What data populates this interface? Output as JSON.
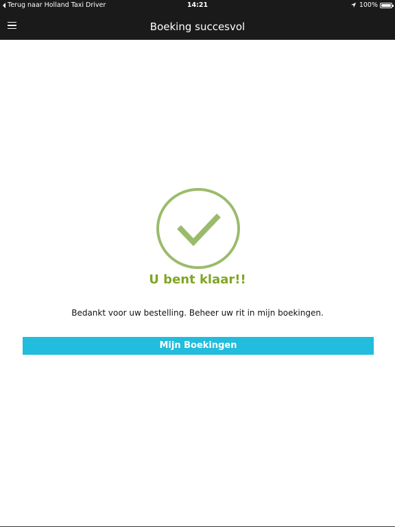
{
  "status_bar": {
    "back_label": "Terug naar Holland Taxi Driver",
    "time": "14:21",
    "battery_percent": "100%",
    "location_icon": "location-arrow-icon",
    "battery_icon": "battery-icon"
  },
  "nav_bar": {
    "title": "Boeking succesvol",
    "menu_icon": "hamburger-menu-icon"
  },
  "confirmation": {
    "icon": "checkmark-circle-icon",
    "title": "U bent klaar!!",
    "message": "Bedankt voor uw bestelling. Beheer uw rit in mijn boekingen.",
    "button_label": "Mijn Boekingen"
  },
  "colors": {
    "bar_background": "#1a1a1a",
    "success_green": "#7fa623",
    "check_circle_green": "#9bbb6c",
    "button_blue": "#22bcdc"
  }
}
